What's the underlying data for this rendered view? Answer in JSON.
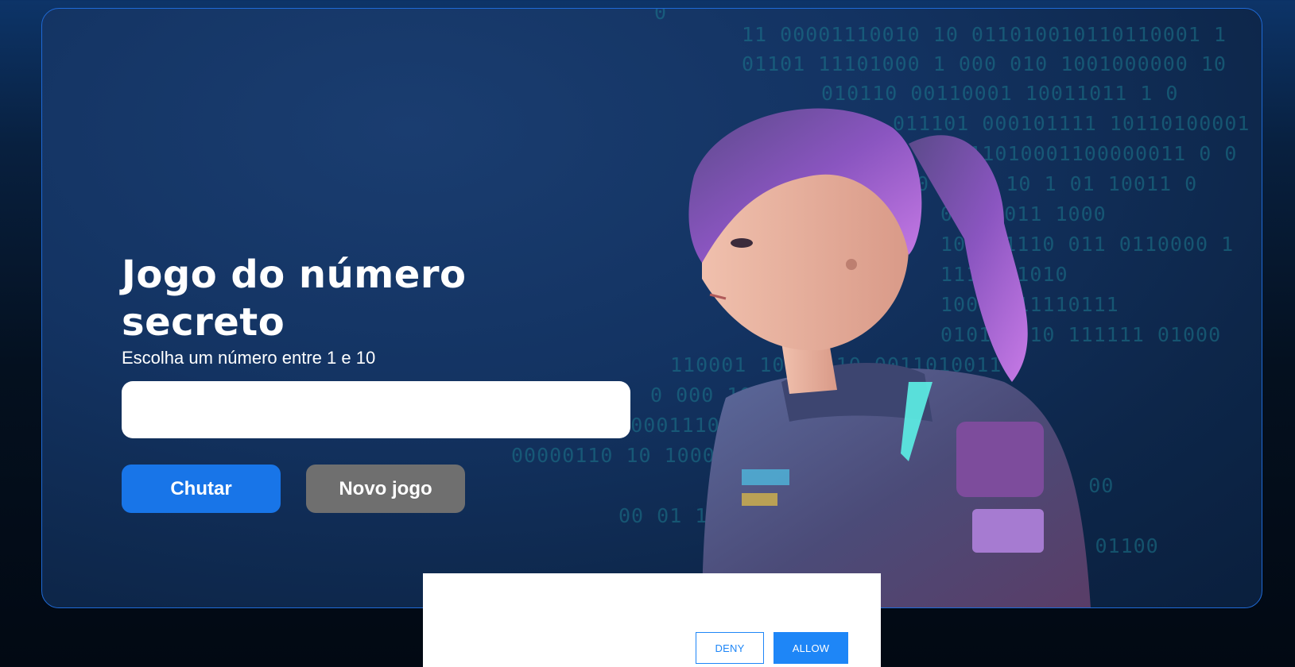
{
  "game": {
    "title": "Jogo do número secreto",
    "subtitle": "Escolha um número entre 1 e 10",
    "input_value": "",
    "guess_button": "Chutar",
    "new_game_button": "Novo jogo"
  },
  "permission_dialog": {
    "deny_label": "DENY",
    "allow_label": "ALLOW"
  },
  "decor": {
    "binary_lines": [
      "0",
      "11 00001110010 10 011010010110110001 1",
      "01101 11101000 1   000 010   1001000000  10",
      "010110    00110001   10011011 1 0",
      "011101  000101111  10110100001",
      "1 1 0011010001100000011 0 0",
      "0 1 01 10  1 01 10011  0",
      "01111011 1000",
      "100101110 011  0110000 1",
      "1111111010",
      "10010111110111",
      "010100010 111111 01000",
      "110001   10010110 00110100110",
      "0 000    1010000101111000 1010",
      "11010000111000 0   0111 10 000101 1",
      "00000110  10  1000001111010001 1",
      "00010 00",
      "00 01   10 000101 11011",
      "0101 010 01100"
    ],
    "accent_colors": {
      "primary": "#1875e8",
      "secondary": "#6f6f6f",
      "dialog_accent": "#1e86f7",
      "frame_border": "#1f6ad6"
    }
  }
}
